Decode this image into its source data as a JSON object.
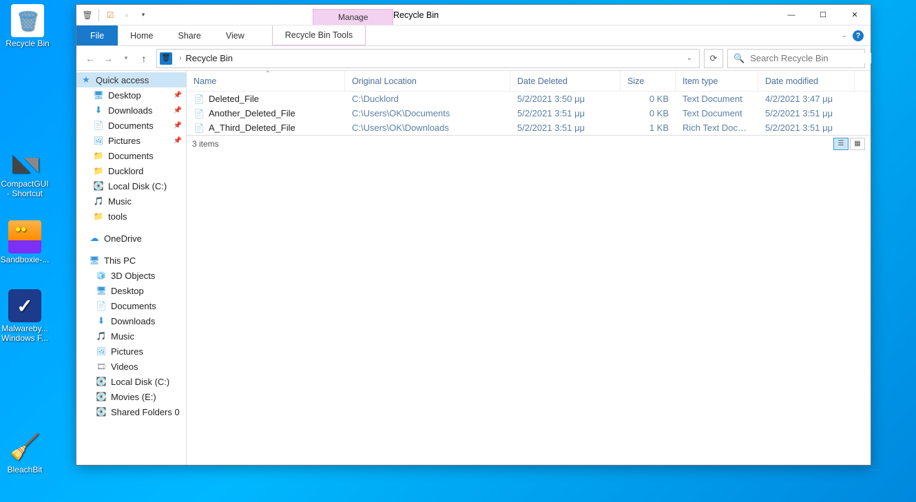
{
  "desktop_icons": [
    {
      "label": "Recycle Bin",
      "kind": "recycle"
    },
    {
      "label": "CompactGUI - Shortcut",
      "kind": "compact"
    },
    {
      "label": "Sandboxie-...",
      "kind": "sandbox"
    },
    {
      "label": "Malwareby... Windows F...",
      "kind": "malware"
    },
    {
      "label": "BleachBit",
      "kind": "bleach"
    }
  ],
  "window": {
    "title": "Recycle Bin",
    "context_tab": "Manage",
    "ribbon": {
      "file": "File",
      "tabs": [
        "Home",
        "Share",
        "View"
      ],
      "context": "Recycle Bin Tools"
    },
    "address": {
      "crumb": "Recycle Bin"
    },
    "search_placeholder": "Search Recycle Bin",
    "columns": {
      "name": "Name",
      "orig": "Original Location",
      "del": "Date Deleted",
      "size": "Size",
      "type": "Item type",
      "mod": "Date modified"
    },
    "files": [
      {
        "name": "Deleted_File",
        "orig": "C:\\Ducklord",
        "del": "5/2/2021 3:50 μμ",
        "size": "0 KB",
        "type": "Text Document",
        "mod": "4/2/2021 3:47 μμ",
        "icon": "txt"
      },
      {
        "name": "Another_Deleted_File",
        "orig": "C:\\Users\\OK\\Documents",
        "del": "5/2/2021 3:51 μμ",
        "size": "0 KB",
        "type": "Text Document",
        "mod": "5/2/2021 3:51 μμ",
        "icon": "txt"
      },
      {
        "name": "A_Third_Deleted_File",
        "orig": "C:\\Users\\OK\\Downloads",
        "del": "5/2/2021 3:51 μμ",
        "size": "1 KB",
        "type": "Rich Text Document",
        "mod": "5/2/2021 3:51 μμ",
        "icon": "rtf"
      }
    ],
    "nav": {
      "quick_access": "Quick access",
      "pinned": [
        {
          "label": "Desktop",
          "icon": "desktop",
          "pin": true
        },
        {
          "label": "Downloads",
          "icon": "down",
          "pin": true
        },
        {
          "label": "Documents",
          "icon": "doc",
          "pin": true
        },
        {
          "label": "Pictures",
          "icon": "pic",
          "pin": true
        },
        {
          "label": "Documents",
          "icon": "folder"
        },
        {
          "label": "Ducklord",
          "icon": "folder"
        },
        {
          "label": "Local Disk (C:)",
          "icon": "drive"
        },
        {
          "label": "Music",
          "icon": "music"
        },
        {
          "label": "tools",
          "icon": "folder"
        }
      ],
      "onedrive": "OneDrive",
      "this_pc": "This PC",
      "pc_items": [
        {
          "label": "3D Objects",
          "icon": "3d"
        },
        {
          "label": "Desktop",
          "icon": "desktop"
        },
        {
          "label": "Documents",
          "icon": "doc"
        },
        {
          "label": "Downloads",
          "icon": "down"
        },
        {
          "label": "Music",
          "icon": "music"
        },
        {
          "label": "Pictures",
          "icon": "pic"
        },
        {
          "label": "Videos",
          "icon": "video"
        },
        {
          "label": "Local Disk (C:)",
          "icon": "drive"
        },
        {
          "label": "Movies (E:)",
          "icon": "drive"
        },
        {
          "label": "Shared Folders 0",
          "icon": "drive"
        }
      ]
    },
    "status": "3 items"
  }
}
